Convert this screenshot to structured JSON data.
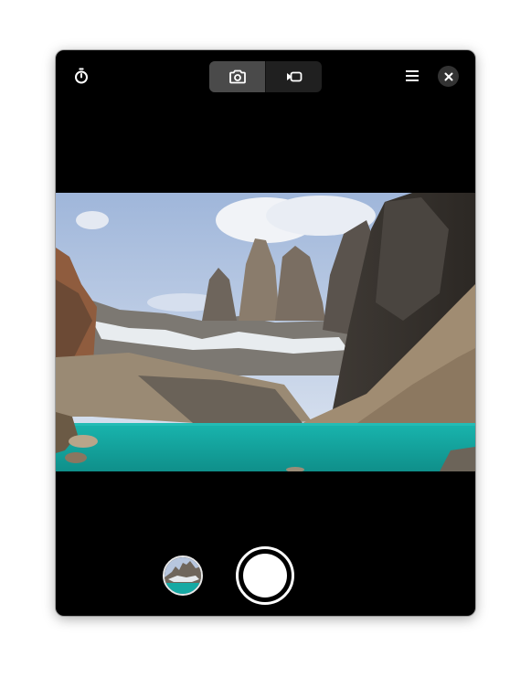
{
  "window": {
    "background": "#000000"
  },
  "header": {
    "timer_icon": "timer-icon",
    "modes": [
      {
        "name": "photo",
        "icon": "camera-icon",
        "active": true
      },
      {
        "name": "video",
        "icon": "video-camera-icon",
        "active": false
      }
    ],
    "menu_icon": "hamburger-menu-icon",
    "close_icon": "close-icon"
  },
  "viewfinder": {
    "scene": "mountain-lake-landscape",
    "colors": {
      "sky": "#b9c9e2",
      "lake": "#14a5a1",
      "rock": "#5e5247"
    }
  },
  "controls": {
    "gallery_thumbnail": "last-photo-thumbnail",
    "shutter": "shutter-button"
  }
}
